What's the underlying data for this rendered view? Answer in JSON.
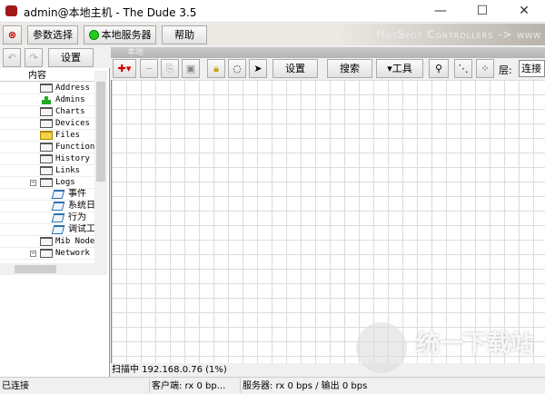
{
  "window": {
    "title": "admin@本地主机 - The Dude 3.5",
    "minimize": "—",
    "maximize": "☐",
    "close": "✕"
  },
  "mainbar": {
    "buttons": [
      {
        "label": "参数选择"
      },
      {
        "label": "本地服务器",
        "status_color": "#22cc22"
      },
      {
        "label": "帮助"
      }
    ],
    "banner": "HotSpot Controllers -> www"
  },
  "left": {
    "toolbar": {
      "settings": "设置"
    },
    "tree_header": "内容",
    "items": [
      {
        "label": "Address",
        "icon": "table-icon"
      },
      {
        "label": "Admins",
        "icon": "user-icon"
      },
      {
        "label": "Charts",
        "icon": "table-icon"
      },
      {
        "label": "Devices",
        "icon": "table-icon"
      },
      {
        "label": "Files",
        "icon": "folder-icon"
      },
      {
        "label": "Functions",
        "icon": "table-icon"
      },
      {
        "label": "History",
        "icon": "table-icon"
      },
      {
        "label": "Links",
        "icon": "table-icon"
      },
      {
        "label": "Logs",
        "icon": "table-icon",
        "expanded": true
      },
      {
        "label": "事件",
        "icon": "log-icon",
        "child": true
      },
      {
        "label": "系统日志",
        "icon": "log-icon",
        "child": true
      },
      {
        "label": "行为",
        "icon": "log-icon",
        "child": true
      },
      {
        "label": "调试工具",
        "icon": "log-icon",
        "child": true
      },
      {
        "label": "Mib Nodes",
        "icon": "table-icon"
      },
      {
        "label": "Network Maps",
        "icon": "table-icon",
        "expanded": true
      }
    ]
  },
  "map": {
    "header": "本地",
    "toolbar": {
      "settings": "设置",
      "search": "搜索",
      "tools": "▾工具",
      "layer_label": "层:",
      "layer_value": "连接"
    },
    "scan_status": "扫描中 192.168.0.76 (1%)"
  },
  "status": {
    "connection": "已连接",
    "client": "客户端: rx 0 bp...",
    "server": "服务器: rx 0 bps / 输出 0 bps"
  },
  "watermark": "统一下载站"
}
